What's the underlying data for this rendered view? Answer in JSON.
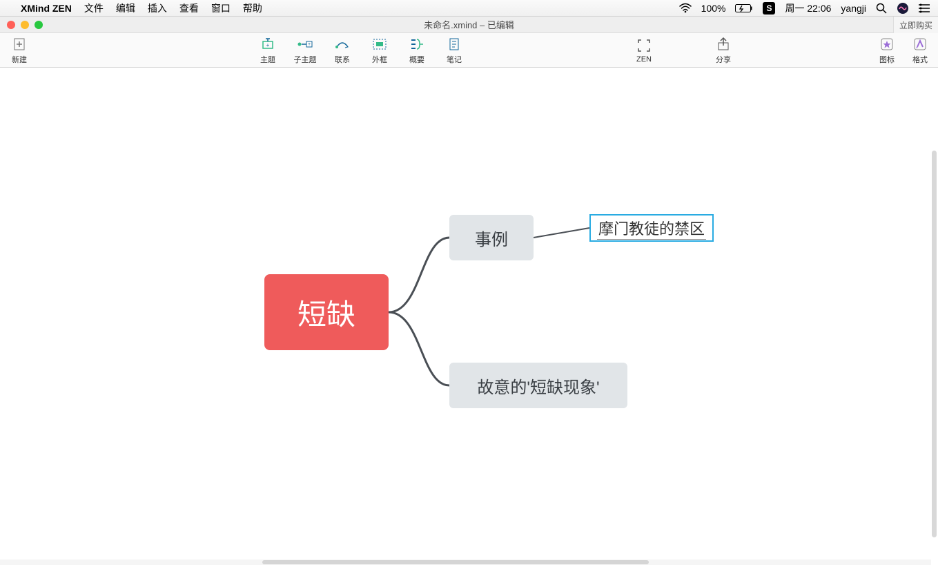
{
  "menubar": {
    "app_name": "XMind ZEN",
    "items": [
      "文件",
      "编辑",
      "插入",
      "查看",
      "窗口",
      "帮助"
    ],
    "battery": "100%",
    "day_time": "周一 22:06",
    "user": "yangji"
  },
  "titlebar": {
    "doc_title": "未命名.xmind – 已编辑",
    "buy": "立即购买"
  },
  "toolbar": {
    "new": "新建",
    "topic": "主题",
    "subtopic": "子主题",
    "relationship": "联系",
    "boundary": "外框",
    "summary": "概要",
    "notes": "笔记",
    "zen": "ZEN",
    "share": "分享",
    "iconset": "图标",
    "format": "格式"
  },
  "mindmap": {
    "central": "短缺",
    "sub1": "事例",
    "sub2": "故意的'短缺现象'",
    "editing": "摩门教徒的禁区"
  }
}
